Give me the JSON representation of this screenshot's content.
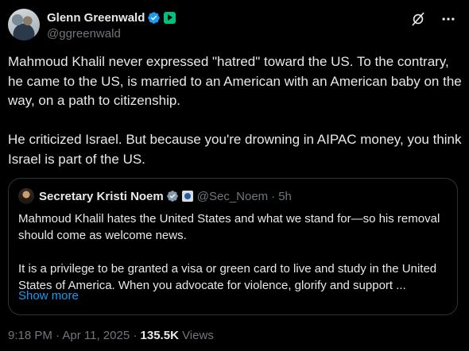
{
  "author": {
    "display_name": "Glenn Greenwald",
    "handle": "@ggreenwald"
  },
  "body": {
    "text": "Mahmoud Khalil never expressed \"hatred\" toward the US. To the contrary, he came to the US, is married to an American with an American baby on the way, on a path to citizenship.\n\nHe criticized Israel. But because you're drowning in AIPAC money, you think Israel is part of the US."
  },
  "quote": {
    "display_name": "Secretary Kristi Noem",
    "handle": "@Sec_Noem",
    "separator": "·",
    "time": "5h",
    "text": "Mahmoud Khalil hates the United States and what we stand for—so his removal should come as welcome news.\n\nIt is a privilege to be granted a visa or green card to live and study in the United States of America. When you advocate for violence, glorify and support ...",
    "show_more": "Show more"
  },
  "meta": {
    "time": "9:18 PM",
    "sep1": "·",
    "date": "Apr 11, 2025",
    "sep2": "·",
    "views_count": "135.5K",
    "views_label": "Views"
  },
  "colors": {
    "background": "#000000",
    "text": "#e7e9ea",
    "secondary": "#71767b",
    "accent": "#1d9bf0",
    "border": "#2f3336"
  },
  "icons": {
    "verified": "verified-badge-icon",
    "subscription": "subscription-badge-icon",
    "grok": "grok-icon",
    "more": "more-icon",
    "government": "government-badge-icon"
  }
}
